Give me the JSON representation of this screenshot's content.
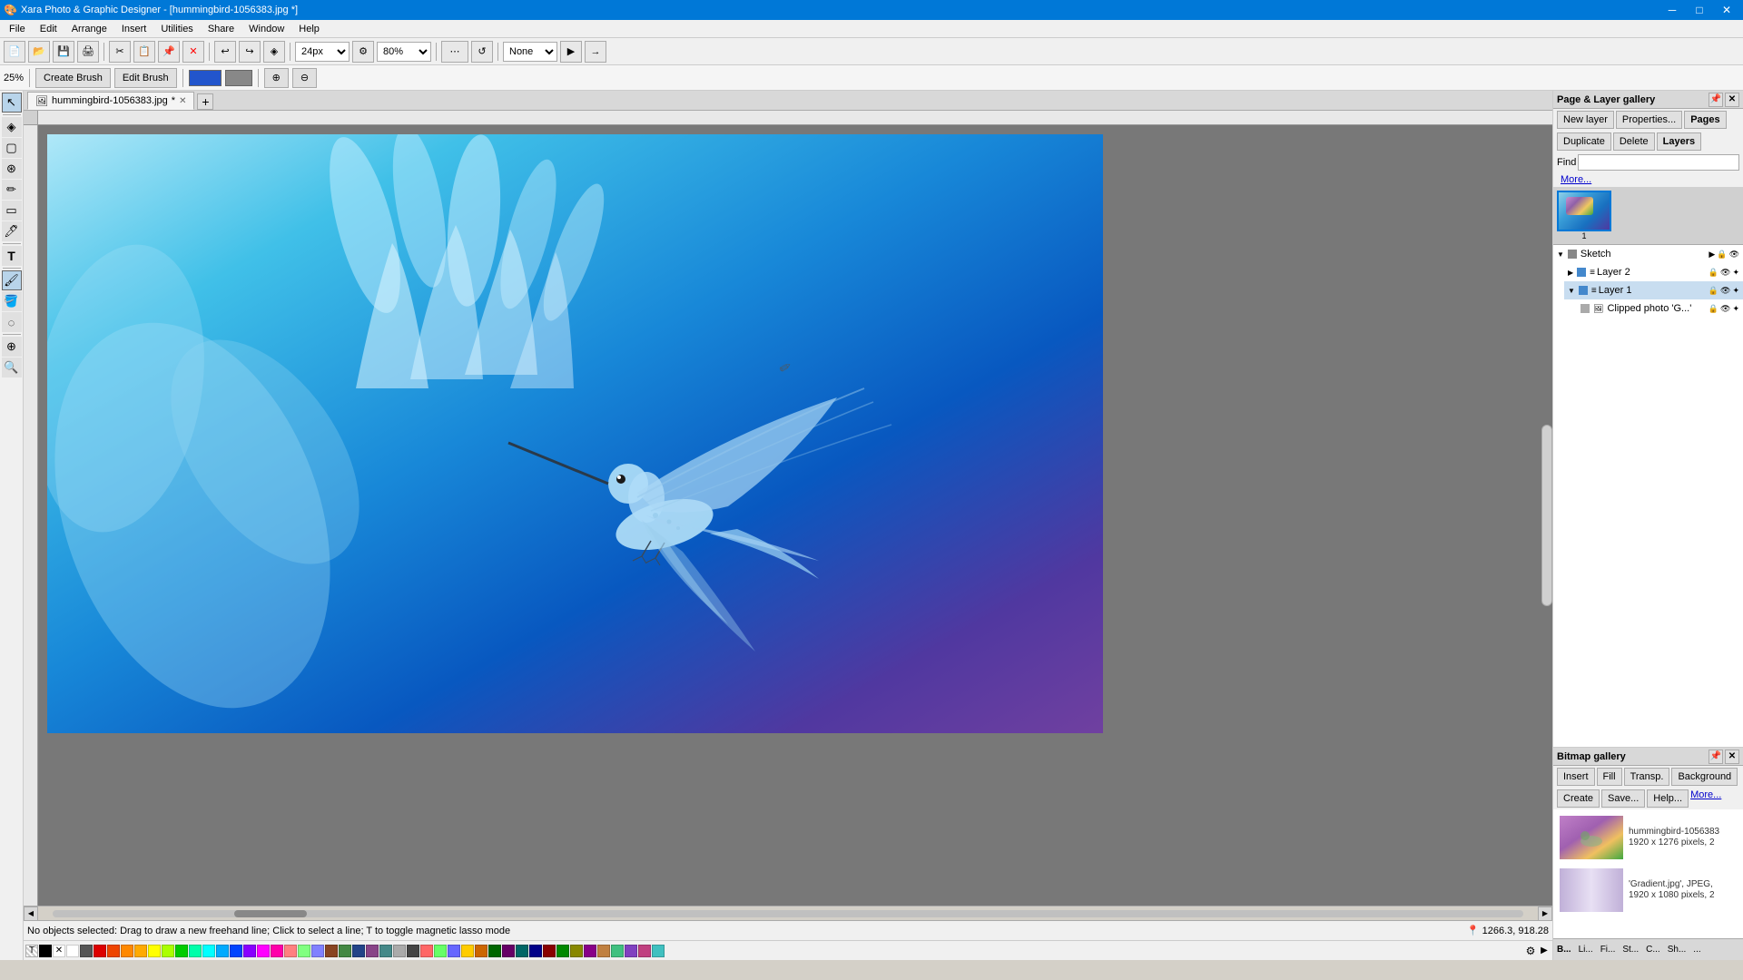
{
  "app": {
    "title": "Xara Photo & Graphic Designer - [hummingbird-1056383.jpg *]",
    "version": "Xara Photo & Graphic Designer"
  },
  "titlebar": {
    "title": "Xara Photo & Graphic Designer - [hummingbird-1056383.jpg *]",
    "minimize": "─",
    "maximize": "□",
    "close": "✕"
  },
  "menubar": {
    "items": [
      "File",
      "Edit",
      "Arrange",
      "Insert",
      "Utilities",
      "Share",
      "Window",
      "Help"
    ]
  },
  "toolbar": {
    "zoom_value": "24px",
    "zoom_percent": "80%",
    "none_label": "None"
  },
  "context_toolbar": {
    "zoom_percent": "25%",
    "create_brush": "Create Brush",
    "edit_brush": "Edit Brush"
  },
  "tab": {
    "name": "hummingbird-1056383.jpg",
    "modified": true
  },
  "page_layer_gallery": {
    "title": "Page & Layer gallery",
    "new_layer": "New layer",
    "properties": "Properties...",
    "pages_tab": "Pages",
    "duplicate": "Duplicate",
    "delete": "Delete",
    "layers_tab": "Layers",
    "find_placeholder": "Find",
    "more_label": "More...",
    "page_number": "1",
    "layers": [
      {
        "name": "Sketch",
        "type": "group",
        "color": "#888",
        "indent": 0
      },
      {
        "name": "Layer 2",
        "type": "layer",
        "color": "#4488cc",
        "indent": 1
      },
      {
        "name": "Layer 1",
        "type": "layer",
        "color": "#4488cc",
        "indent": 1
      },
      {
        "name": "Clipped photo 'G...'",
        "type": "photo",
        "color": "#aaa",
        "indent": 2
      }
    ]
  },
  "bitmap_gallery": {
    "title": "Bitmap gallery",
    "buttons": [
      "Insert",
      "Fill",
      "Transp.",
      "Background",
      "Create",
      "Save...",
      "Help...",
      "More..."
    ],
    "items": [
      {
        "filename": "hummingbird-1056383",
        "details": "1920 x 1276 pixels, 2",
        "type": "hummingbird"
      },
      {
        "filename": "'Gradient.jpg', JPEG,",
        "details": "1920 x 1080 pixels, 2",
        "type": "gradient"
      }
    ]
  },
  "statusbar": {
    "message": "No objects selected: Drag to draw a new freehand line; Click to select a line; T to toggle magnetic lasso mode",
    "coordinates": "1266.3, 918.28"
  },
  "palette": {
    "swatches": [
      "#000000",
      "#ffffff",
      "#808080",
      "#ff0000",
      "#ff4000",
      "#ff8000",
      "#ffaa00",
      "#ffff00",
      "#aaff00",
      "#00ff00",
      "#00ffaa",
      "#00ffff",
      "#00aaff",
      "#0000ff",
      "#aa00ff",
      "#ff00ff",
      "#ff00aa",
      "#ff8080",
      "#80ff80",
      "#8080ff",
      "#804040",
      "#408040",
      "#404080",
      "#804080",
      "#408080",
      "#c0c0c0",
      "#404040",
      "#ff6060",
      "#60ff60",
      "#6060ff",
      "#ffcc00",
      "#cc6600",
      "#006600",
      "#660066",
      "#006666",
      "#000080",
      "#800000",
      "#008000",
      "#808000",
      "#800080",
      "#c08040",
      "#40c080",
      "#8040c0",
      "#c04080",
      "#40c0c0",
      "#ffffff",
      "#cccccc",
      "#999999",
      "#666666",
      "#333333",
      "#000000"
    ]
  }
}
